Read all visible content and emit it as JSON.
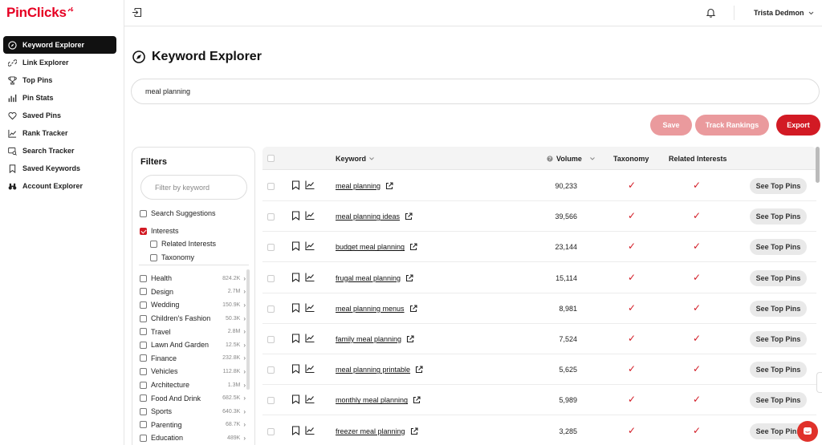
{
  "app": {
    "logo": "PinClicks",
    "brand_color": "#e60023"
  },
  "sidebar": {
    "items": [
      {
        "label": "Keyword Explorer",
        "icon": "compass-icon",
        "active": true
      },
      {
        "label": "Link Explorer",
        "icon": "link-icon"
      },
      {
        "label": "Top Pins",
        "icon": "trophy-icon"
      },
      {
        "label": "Pin Stats",
        "icon": "bar-chart-icon"
      },
      {
        "label": "Saved Pins",
        "icon": "heart-icon"
      },
      {
        "label": "Rank Tracker",
        "icon": "line-chart-icon"
      },
      {
        "label": "Search Tracker",
        "icon": "search-screen-icon"
      },
      {
        "label": "Saved Keywords",
        "icon": "bookmark-icon"
      },
      {
        "label": "Account Explorer",
        "icon": "binoculars-icon"
      }
    ]
  },
  "topbar": {
    "user_name": "Trista Dedmon"
  },
  "main": {
    "title": "Keyword Explorer",
    "search_value": "meal planning",
    "buttons": {
      "save": "Save",
      "track": "Track Rankings",
      "export": "Export"
    }
  },
  "filters": {
    "title": "Filters",
    "search_placeholder": "Filter by keyword",
    "options": {
      "search_suggestions": "Search Suggestions",
      "interests": "Interests",
      "related_interests": "Related Interests",
      "taxonomy": "Taxonomy"
    },
    "categories": [
      {
        "name": "Health",
        "count": "824.2K"
      },
      {
        "name": "Design",
        "count": "2.7M"
      },
      {
        "name": "Wedding",
        "count": "150.9K"
      },
      {
        "name": "Children's Fashion",
        "count": "50.3K"
      },
      {
        "name": "Travel",
        "count": "2.8M"
      },
      {
        "name": "Lawn And Garden",
        "count": "12.5K"
      },
      {
        "name": "Finance",
        "count": "232.8K"
      },
      {
        "name": "Vehicles",
        "count": "112.8K"
      },
      {
        "name": "Architecture",
        "count": "1.3M"
      },
      {
        "name": "Food And Drink",
        "count": "682.5K"
      },
      {
        "name": "Sports",
        "count": "640.3K"
      },
      {
        "name": "Parenting",
        "count": "68.7K"
      },
      {
        "name": "Education",
        "count": "489K"
      }
    ]
  },
  "table": {
    "columns": {
      "keyword": "Keyword",
      "volume": "Volume",
      "taxonomy": "Taxonomy",
      "related": "Related Interests"
    },
    "action_label": "See Top Pins",
    "check_color": "#d21a24",
    "rows": [
      {
        "keyword": "meal planning",
        "volume": "90,233"
      },
      {
        "keyword": "meal planning ideas",
        "volume": "39,566"
      },
      {
        "keyword": "budget meal planning",
        "volume": "23,144"
      },
      {
        "keyword": "frugal meal planning",
        "volume": "15,114"
      },
      {
        "keyword": "meal planning menus",
        "volume": "8,981"
      },
      {
        "keyword": "family meal planning",
        "volume": "7,524"
      },
      {
        "keyword": "meal planning printable",
        "volume": "5,625"
      },
      {
        "keyword": "monthly meal planning",
        "volume": "5,989"
      },
      {
        "keyword": "freezer meal planning",
        "volume": "3,285"
      }
    ]
  }
}
